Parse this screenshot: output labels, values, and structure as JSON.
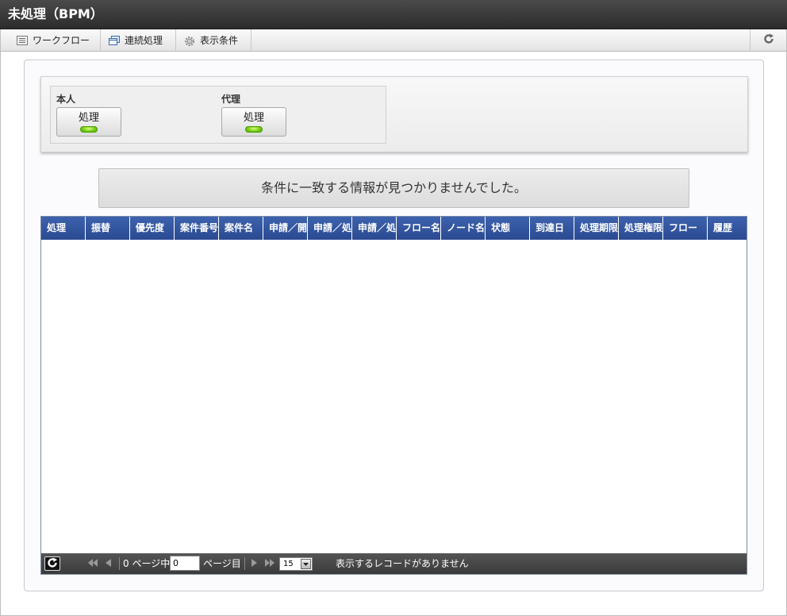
{
  "window": {
    "title": "未処理（BPM）"
  },
  "toolbar": {
    "items": [
      {
        "label": "ワークフロー",
        "icon": "list-icon"
      },
      {
        "label": "連続処理",
        "icon": "windows-icon"
      },
      {
        "label": "表示条件",
        "icon": "gear-icon"
      }
    ],
    "refresh_icon": "refresh-icon"
  },
  "process_panel": {
    "self": {
      "label": "本人",
      "button": "処理"
    },
    "proxy": {
      "label": "代理",
      "button": "処理"
    }
  },
  "message": "条件に一致する情報が見つかりませんでした。",
  "grid": {
    "columns": [
      "処理",
      "振替",
      "優先度",
      "案件番号",
      "案件名",
      "申請／開",
      "申請／処",
      "申請／処",
      "フロー名",
      "ノード名",
      "状態",
      "到達日",
      "処理期限",
      "処理権限",
      "フロー",
      "履歴"
    ]
  },
  "pager": {
    "page_prefix": "0 ページ中",
    "page_value": "0",
    "page_suffix": "ページ目",
    "page_size": "15",
    "status": "表示するレコードがありません"
  },
  "colors": {
    "grid_header": "#2f509a",
    "pager_bg": "#454545",
    "led": "#6ccc00"
  }
}
